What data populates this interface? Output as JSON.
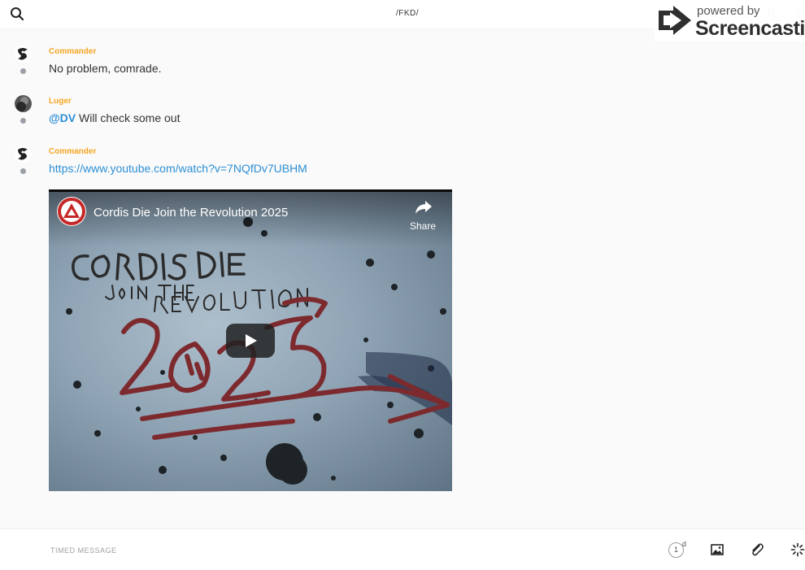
{
  "header": {
    "channel_title": "/FKD/",
    "icons": [
      "search-icon",
      "phone-icon",
      "info-icon"
    ]
  },
  "watermark": {
    "small_text": "powered by",
    "brand": "Screencastify"
  },
  "messages": [
    {
      "author": "Commander",
      "text": "No problem, comrade.",
      "avatar": "commander-avatar"
    },
    {
      "author": "Luger",
      "mention": "@DV",
      "text": " Will check some out",
      "avatar": "luger-avatar"
    },
    {
      "author": "Commander",
      "link": "https://www.youtube.com/watch?v=7NQfDv7UBHM",
      "avatar": "commander-avatar"
    }
  ],
  "video": {
    "title": "Cordis Die Join the Revolution 2025",
    "share_label": "Share",
    "colors": {
      "graffiti_red": "#7d2a2e",
      "graffiti_black": "#2b2b2b"
    }
  },
  "composer": {
    "placeholder": "TIMED MESSAGE",
    "timer_value": "1",
    "timer_unit": "d",
    "icons": [
      "timer-icon",
      "image-icon",
      "paperclip-icon",
      "spinner-icon"
    ]
  },
  "colors": {
    "author": "#f5a623",
    "link": "#2d8fd5",
    "background": "#fafafa"
  }
}
